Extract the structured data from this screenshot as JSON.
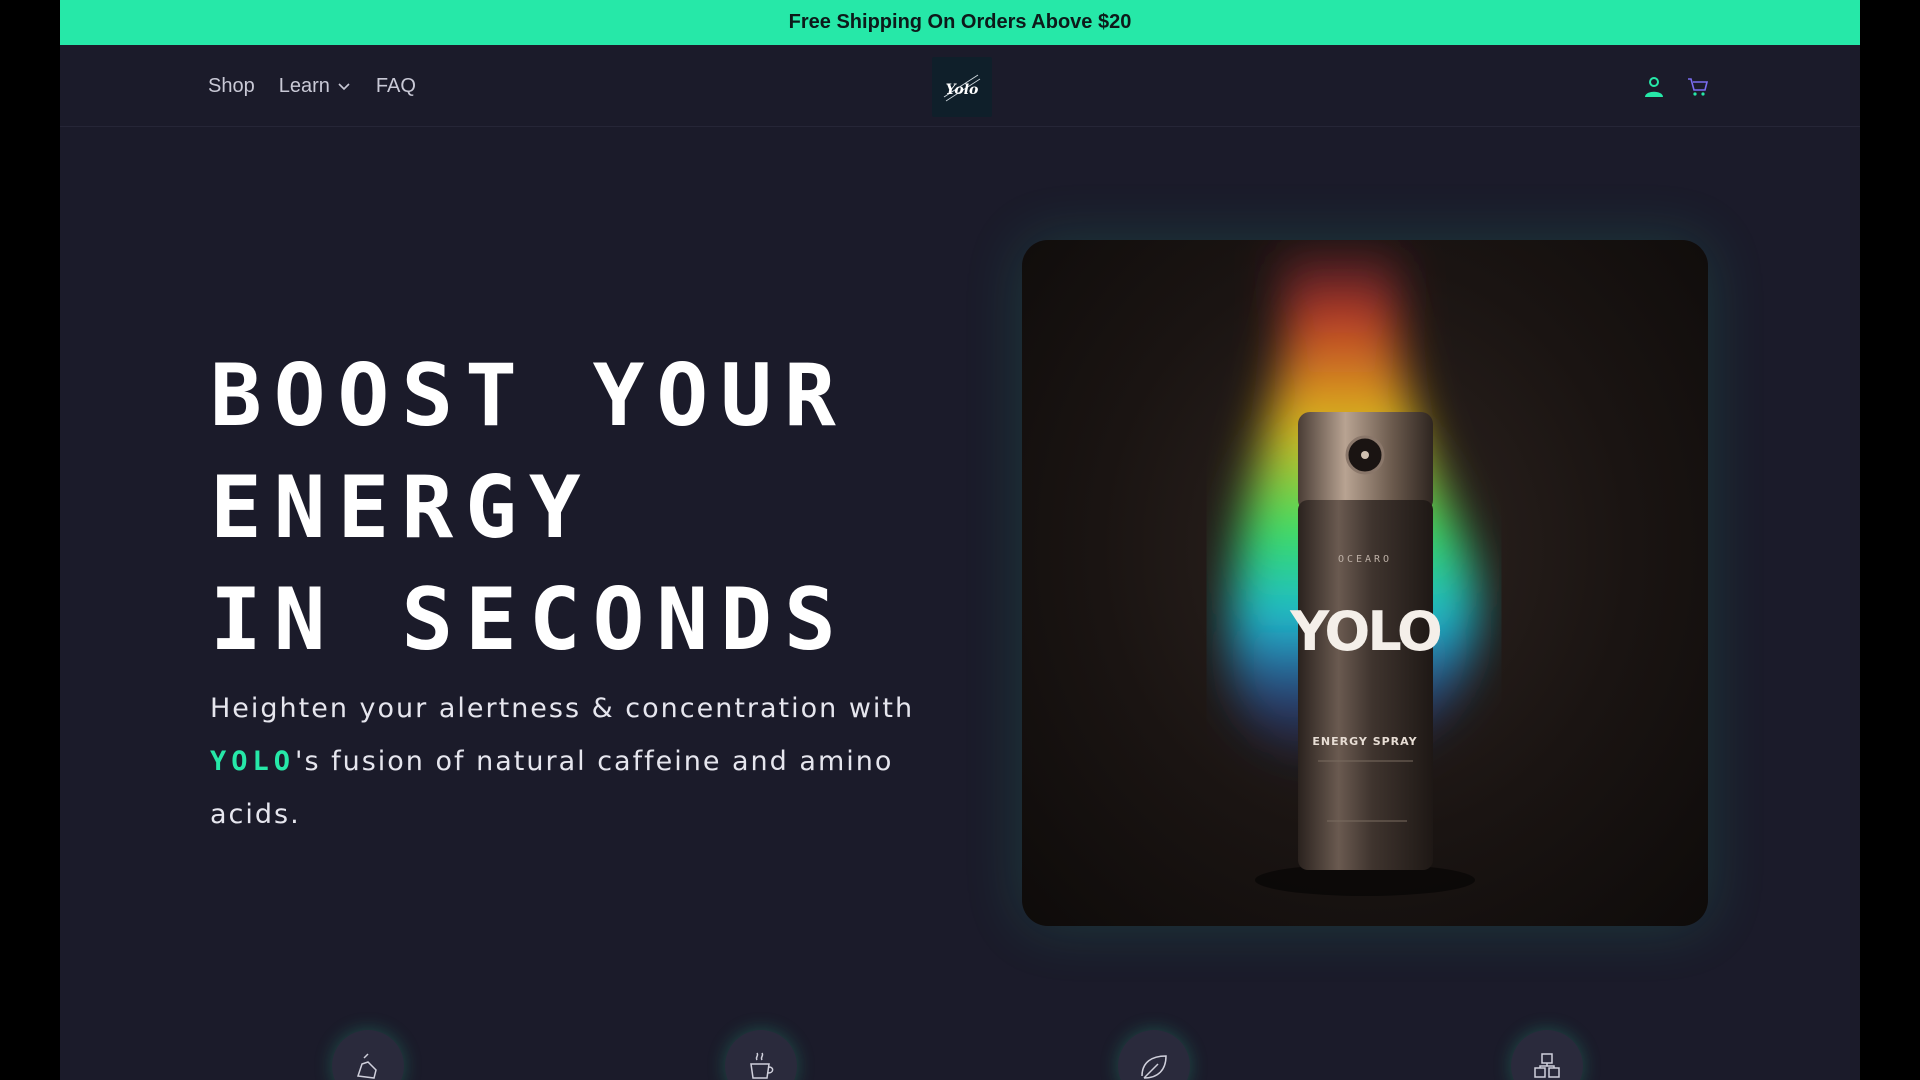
{
  "announcement": {
    "text": "Free Shipping On Orders Above $20"
  },
  "nav": {
    "links": [
      {
        "label": "Shop"
      },
      {
        "label": "Learn"
      },
      {
        "label": "FAQ"
      }
    ],
    "logo_text": "Yolo",
    "icons": [
      "account-icon",
      "cart-icon"
    ]
  },
  "hero": {
    "title_lines": [
      "Boost your",
      "energy",
      "in seconds"
    ],
    "subtitle_pre": "Heighten your alertness & concentration with ",
    "subtitle_brand": "YOLO",
    "subtitle_post": "'s fusion of natural caffeine and amino acids.",
    "product": {
      "brand_small": "OCEARO",
      "name": "YOLO",
      "label": "ENERGY SPRAY"
    }
  },
  "features": {
    "icons": [
      "spray-hand-icon",
      "coffee-cup-icon",
      "leaf-icon",
      "molecule-icon"
    ]
  },
  "colors": {
    "accent": "#26e8a8",
    "background": "#1b1b2a"
  }
}
